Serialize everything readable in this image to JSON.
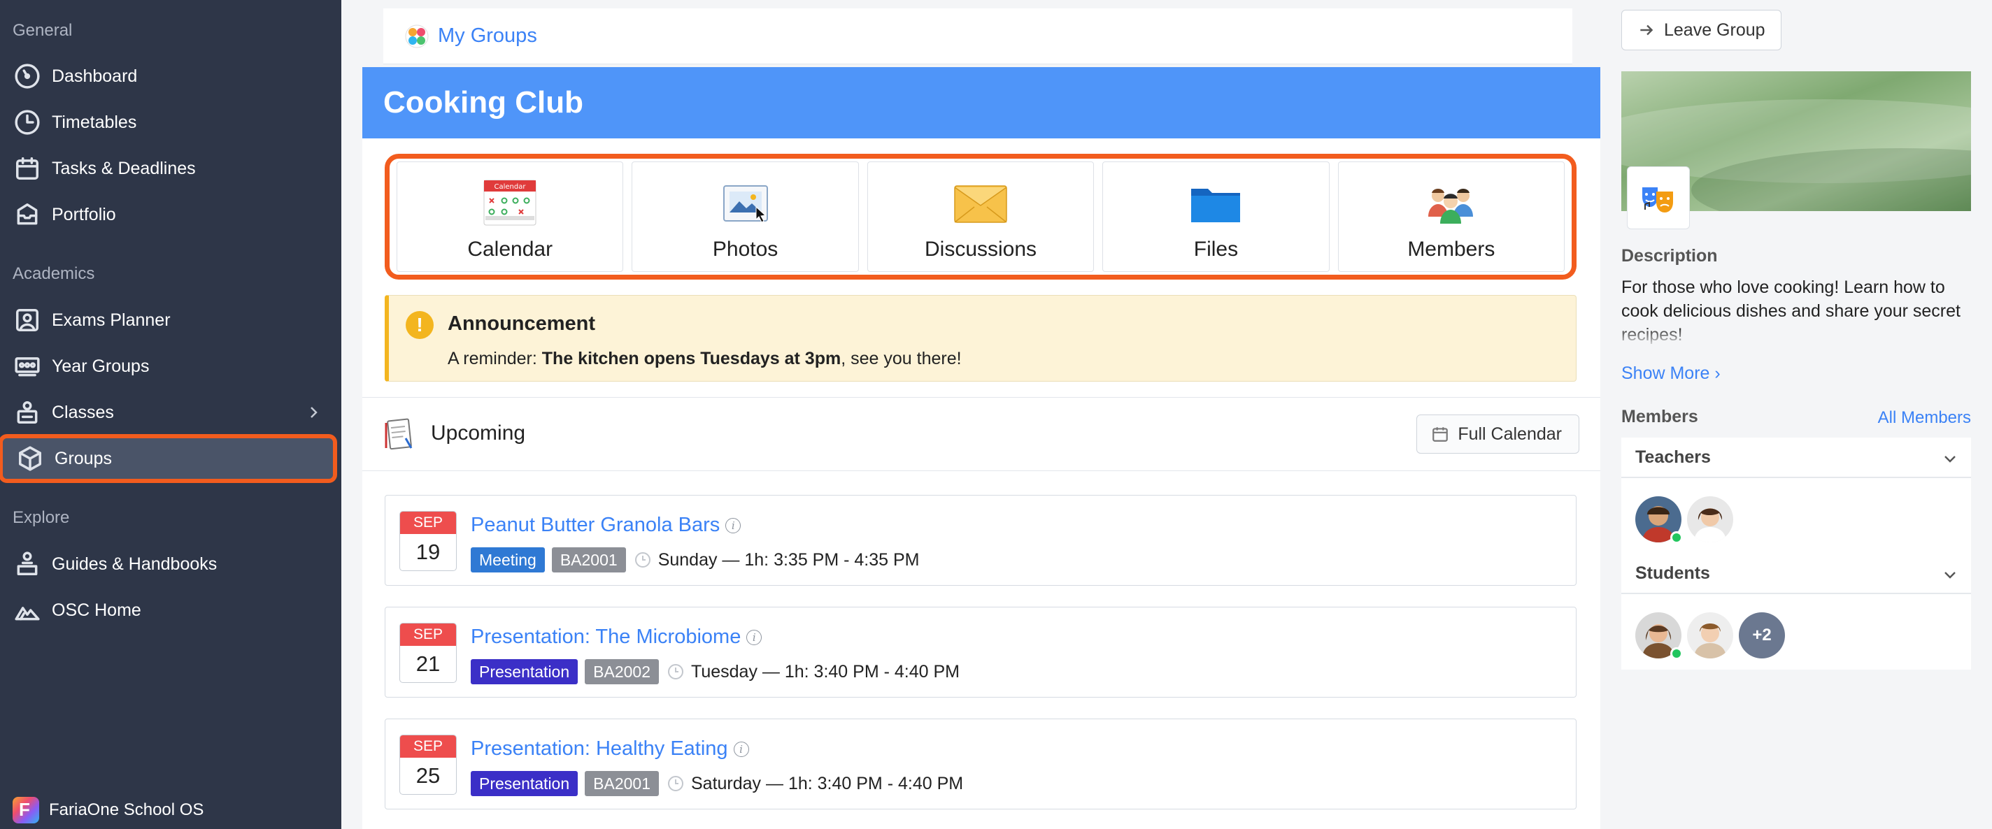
{
  "sidebar": {
    "sections": {
      "general": "General",
      "academics": "Academics",
      "explore": "Explore"
    },
    "items": [
      {
        "label": "Dashboard"
      },
      {
        "label": "Timetables"
      },
      {
        "label": "Tasks & Deadlines"
      },
      {
        "label": "Portfolio"
      },
      {
        "label": "Exams Planner"
      },
      {
        "label": "Year Groups"
      },
      {
        "label": "Classes"
      },
      {
        "label": "Groups"
      },
      {
        "label": "Guides & Handbooks"
      },
      {
        "label": "OSC Home"
      }
    ],
    "active": "Groups",
    "brand": "FariaOne School OS"
  },
  "breadcrumb": {
    "label": "My Groups"
  },
  "group": {
    "name": "Cooking Club",
    "tools": [
      {
        "label": "Calendar",
        "icon": "calendar-icon"
      },
      {
        "label": "Photos",
        "icon": "photos-icon"
      },
      {
        "label": "Discussions",
        "icon": "envelope-icon"
      },
      {
        "label": "Files",
        "icon": "folder-icon"
      },
      {
        "label": "Members",
        "icon": "people-icon"
      }
    ]
  },
  "announcement": {
    "title": "Announcement",
    "prefix": "A reminder: ",
    "bold": "The kitchen opens Tuesdays at 3pm",
    "suffix": ", see you there!"
  },
  "upcoming": {
    "title": "Upcoming",
    "full_calendar": "Full Calendar",
    "events": [
      {
        "month": "SEP",
        "day": "19",
        "title": "Peanut Butter Granola Bars",
        "type": "Meeting",
        "room": "BA2001",
        "time": "Sunday — 1h: 3:35 PM - 4:35 PM"
      },
      {
        "month": "SEP",
        "day": "21",
        "title": "Presentation: The Microbiome",
        "type": "Presentation",
        "room": "BA2002",
        "time": "Tuesday — 1h: 3:40 PM - 4:40 PM"
      },
      {
        "month": "SEP",
        "day": "25",
        "title": "Presentation: Healthy Eating",
        "type": "Presentation",
        "room": "BA2001",
        "time": "Saturday — 1h: 3:40 PM - 4:40 PM"
      }
    ]
  },
  "right_panel": {
    "leave_group": "Leave Group",
    "description_label": "Description",
    "description": "For those who love cooking! Learn how to cook delicious dishes and share your secret recipes!",
    "show_more": "Show More",
    "members_label": "Members",
    "all_members": "All Members",
    "teachers_label": "Teachers",
    "students_label": "Students",
    "students_more": "+2"
  },
  "colors": {
    "sidebar_bg": "#2e3648",
    "accent_blue": "#4f95f9",
    "link_blue": "#3b82f6",
    "highlight_orange": "#f25c1e",
    "announcement_bg": "#fdf3d7"
  }
}
